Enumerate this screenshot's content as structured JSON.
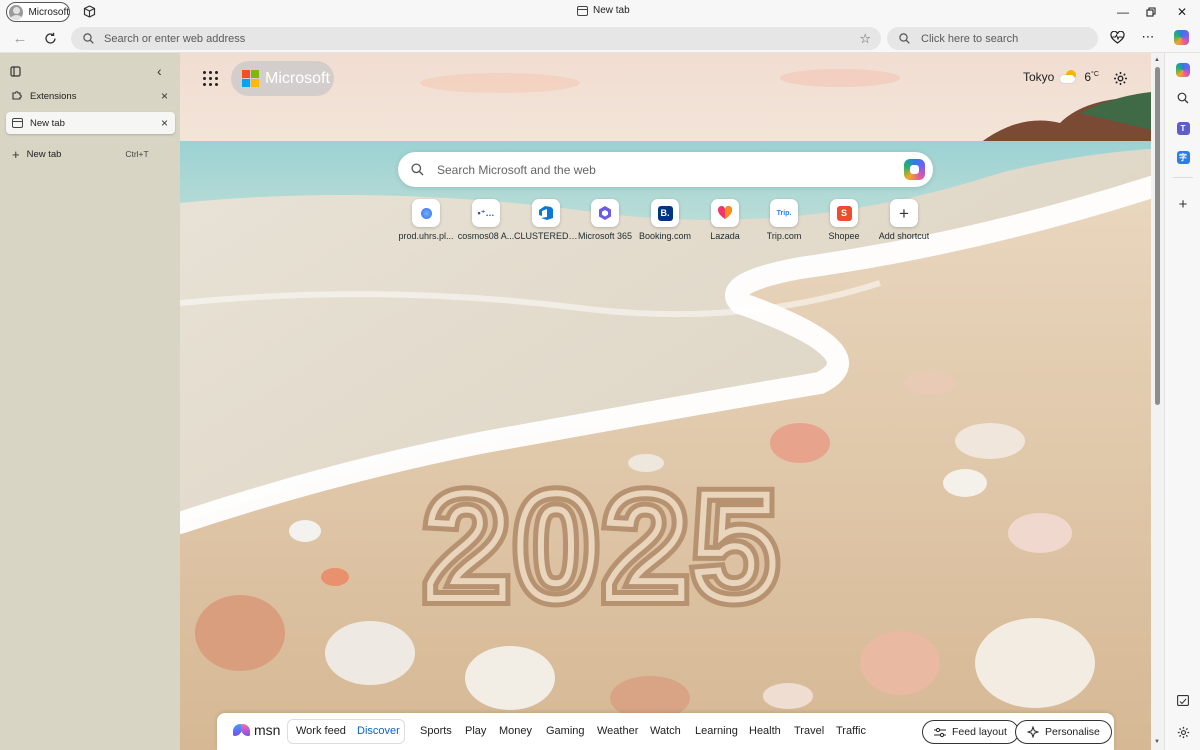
{
  "window": {
    "profile_label": "Microsoft",
    "title": "New tab"
  },
  "nav": {
    "address_placeholder": "Search or enter web address",
    "search_placeholder": "Click here to search"
  },
  "vertical_tabs": {
    "items": [
      {
        "label": "Extensions"
      },
      {
        "label": "New tab"
      }
    ],
    "new_tab_label": "New tab",
    "new_tab_shortcut": "Ctrl+T"
  },
  "new_tab_page": {
    "brand": "Microsoft",
    "weather": {
      "city": "Tokyo",
      "temperature": "6",
      "unit": "°C"
    },
    "search_placeholder": "Search Microsoft and the web",
    "background_text": "2025",
    "shortcuts": [
      {
        "label": "prod.uhrs.pl...",
        "icon": "uhrs-icon",
        "color": "#3a7cff"
      },
      {
        "label": "cosmos08 A...",
        "icon": "cosmos-icon",
        "color": "#2b4f9e"
      },
      {
        "label": "CLUSTERED ...",
        "icon": "azure-devops-icon",
        "color": "#0a78d4"
      },
      {
        "label": "Microsoft 365",
        "icon": "microsoft-365-icon",
        "color": "#6b5be6"
      },
      {
        "label": "Booking.com",
        "icon": "booking-icon",
        "color": "#003580"
      },
      {
        "label": "Lazada",
        "icon": "lazada-icon",
        "color": "#f2356a"
      },
      {
        "label": "Trip.com",
        "icon": "trip-icon",
        "color": "#287dfa"
      },
      {
        "label": "Shopee",
        "icon": "shopee-icon",
        "color": "#ee4d2d"
      },
      {
        "label": "Add shortcut",
        "icon": "plus-icon",
        "color": "#333333"
      }
    ]
  },
  "msn": {
    "logo": "msn",
    "tabs": [
      "Work feed",
      "Discover",
      "Sports",
      "Play",
      "Money",
      "Gaming",
      "Weather",
      "Watch",
      "Learning",
      "Health",
      "Travel",
      "Traffic"
    ],
    "active_tab": "Discover",
    "feed_layout_label": "Feed layout",
    "personalise_label": "Personalise"
  },
  "colors": {
    "accent": "#0b62c9",
    "sidebar_bg": "#d9d5c4"
  }
}
